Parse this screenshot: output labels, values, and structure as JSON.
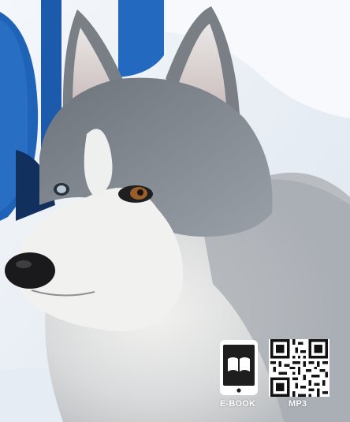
{
  "badges": {
    "ebook_label": "E-BOOK",
    "mp3_label": "MP3"
  },
  "colors": {
    "blue_letter": "#1e63b8",
    "dark_navy": "#12305e",
    "snow": "#eef2f7",
    "fur_grey": "#8f959c"
  },
  "icons": {
    "ebook": "tablet-book-icon",
    "mp3": "qr-code-icon"
  }
}
